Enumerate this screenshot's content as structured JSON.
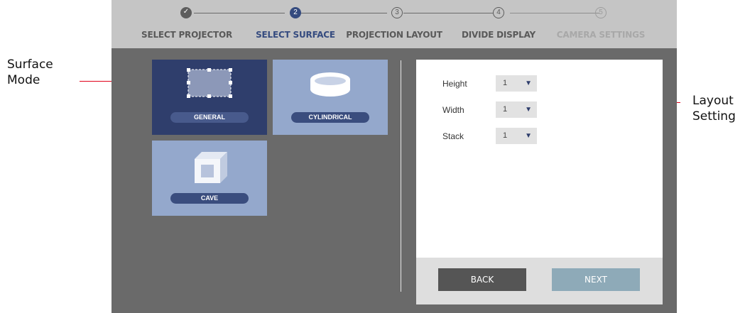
{
  "annotations": {
    "surface_mode": [
      "Surface",
      "Mode"
    ],
    "layout_setting": [
      "Layout",
      "Setting"
    ]
  },
  "stepper": {
    "steps": [
      {
        "number": "✓",
        "label": "SELECT PROJECTOR",
        "state": "done"
      },
      {
        "number": "2",
        "label": "SELECT SURFACE",
        "state": "active"
      },
      {
        "number": "3",
        "label": "PROJECTION LAYOUT",
        "state": "pending"
      },
      {
        "number": "4",
        "label": "DIVIDE DISPLAY",
        "state": "pending"
      },
      {
        "number": "5",
        "label": "CAMERA SETTINGS",
        "state": "disabled"
      }
    ]
  },
  "surfaces": {
    "selected": "GENERAL",
    "items": [
      {
        "label": "GENERAL",
        "icon": "rectangle-grid-icon"
      },
      {
        "label": "CYLINDRICAL",
        "icon": "cylinder-icon"
      },
      {
        "label": "CAVE",
        "icon": "cube-icon"
      }
    ]
  },
  "layout": {
    "fields": [
      {
        "label": "Height",
        "value": "1"
      },
      {
        "label": "Width",
        "value": "1"
      },
      {
        "label": "Stack",
        "value": "1"
      }
    ]
  },
  "footer": {
    "back_label": "BACK",
    "next_label": "NEXT"
  },
  "colors": {
    "accent": "#354b7f",
    "selected_card": "#2f3e6c",
    "card": "#94a8cc",
    "annotation": "#e0001a"
  }
}
